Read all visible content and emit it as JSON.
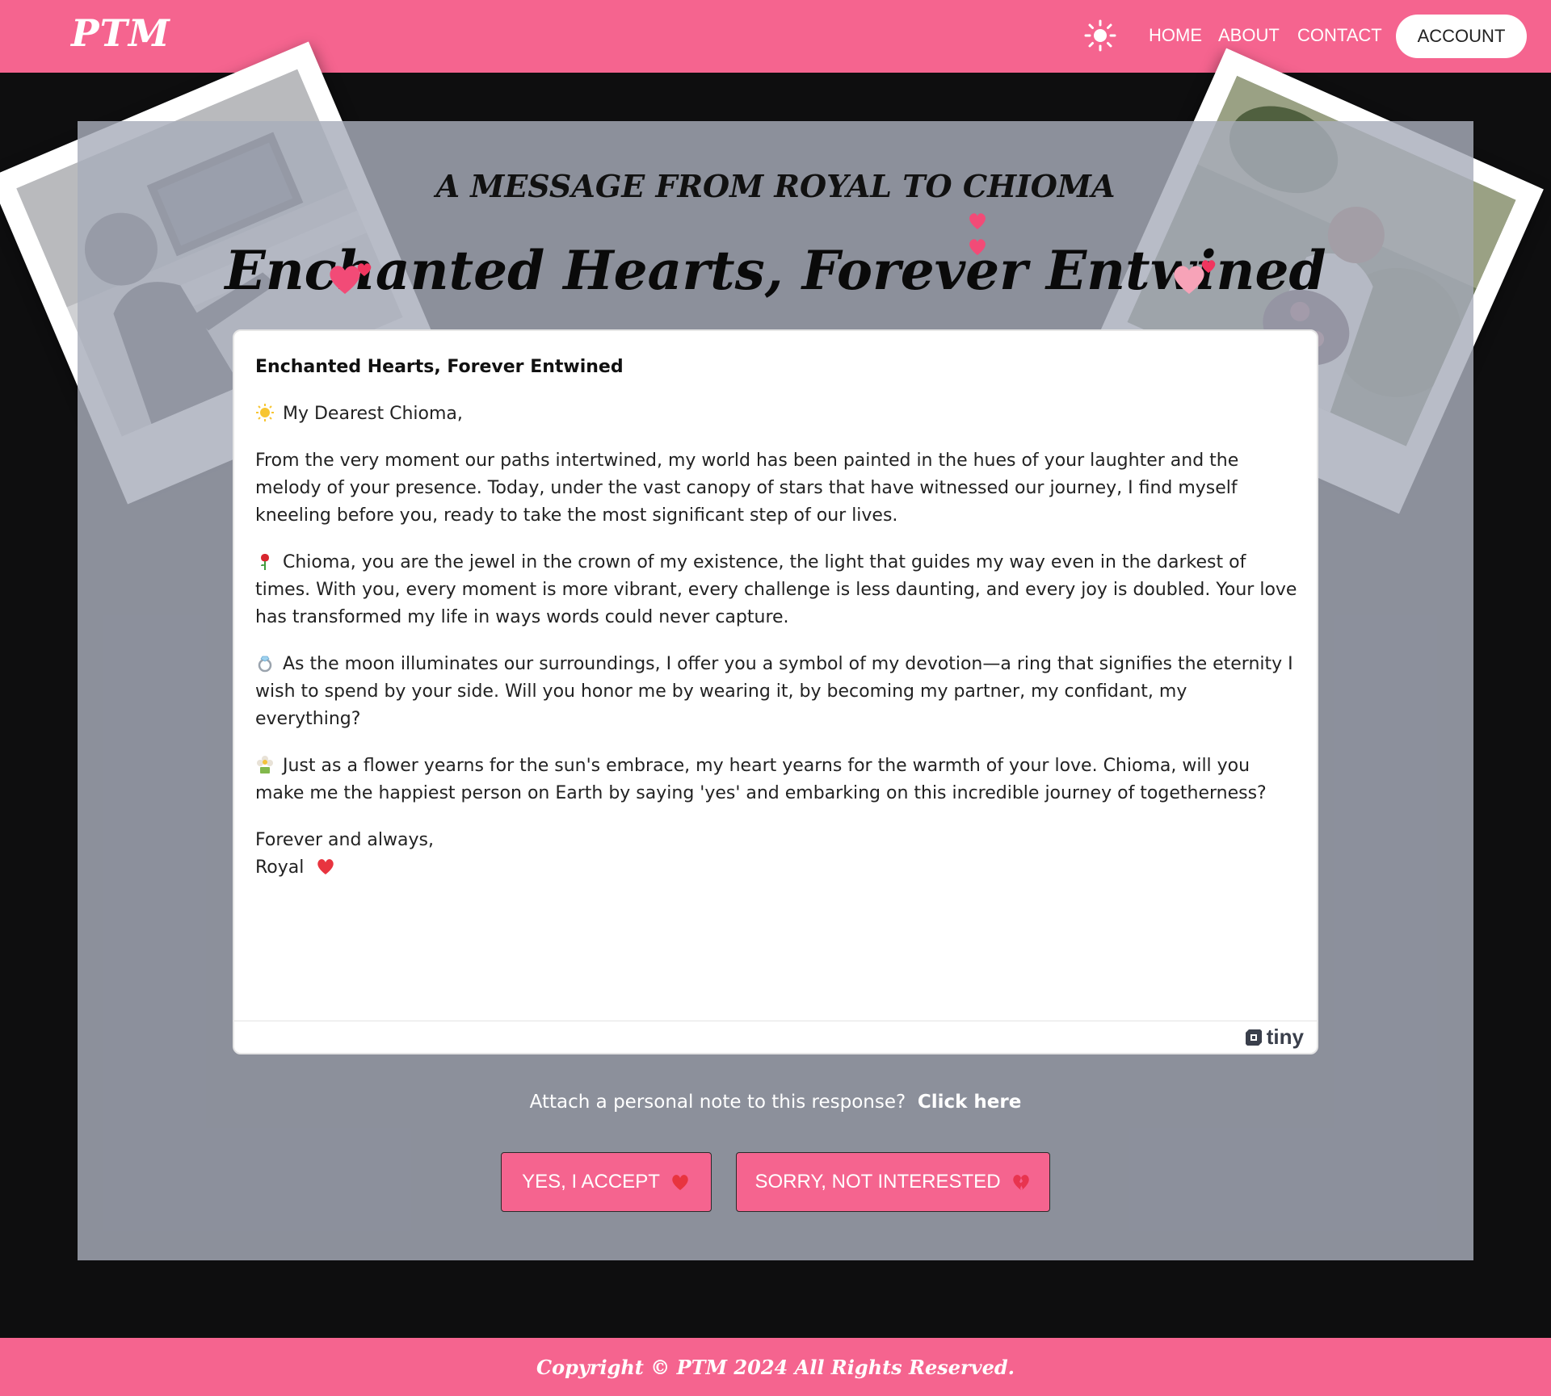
{
  "header": {
    "logo": "PTM",
    "theme_icon": "sun-icon",
    "nav": [
      "HOME",
      "ABOUT",
      "CONTACT"
    ],
    "account_label": "ACCOUNT"
  },
  "colors": {
    "brand_pink": "#f5648f",
    "background": "#0e0e0f",
    "panel": "#a8adbb",
    "heart_red": "#e8343f"
  },
  "hero": {
    "subtitle": "A MESSAGE FROM ROYAL TO CHIOMA",
    "title": "Enchanted Hearts, Forever Entwined"
  },
  "editor": {
    "heading": "Enchanted Hearts, Forever Entwined",
    "greeting": "My Dearest Chioma,",
    "paragraphs": [
      "From the very moment our paths intertwined, my world has been painted in the hues of your laughter and the melody of your presence. Today, under the vast canopy of stars that have witnessed our journey, I find myself kneeling before you, ready to take the most significant step of our lives.",
      "Chioma, you are the jewel in the crown of my existence, the light that guides my way even in the darkest of times. With you, every moment is more vibrant, every challenge is less daunting, and every joy is doubled. Your love has transformed my life in ways words could never capture.",
      "As the moon illuminates our surroundings, I offer you a symbol of my devotion—a ring that signifies the eternity I wish to spend by your side. Will you honor me by wearing it, by becoming my partner, my confidant, my everything?",
      "Just as a flower yearns for the sun's embrace, my heart yearns for the warmth of your love. Chioma, will you make me the happiest person on Earth by saying 'yes' and embarking on this incredible journey of togetherness?"
    ],
    "paragraph_icons": [
      "rose-icon",
      "ring-icon",
      "flower-icon"
    ],
    "closing": "Forever and always,",
    "signature": "Royal",
    "brand": "tiny"
  },
  "note": {
    "prompt": "Attach a personal note to this response?",
    "link": "Click here"
  },
  "actions": {
    "accept": "YES, I ACCEPT",
    "decline": "SORRY, NOT INTERESTED"
  },
  "footer": {
    "copyright": "Copyright © PTM 2024 All Rights Reserved."
  }
}
